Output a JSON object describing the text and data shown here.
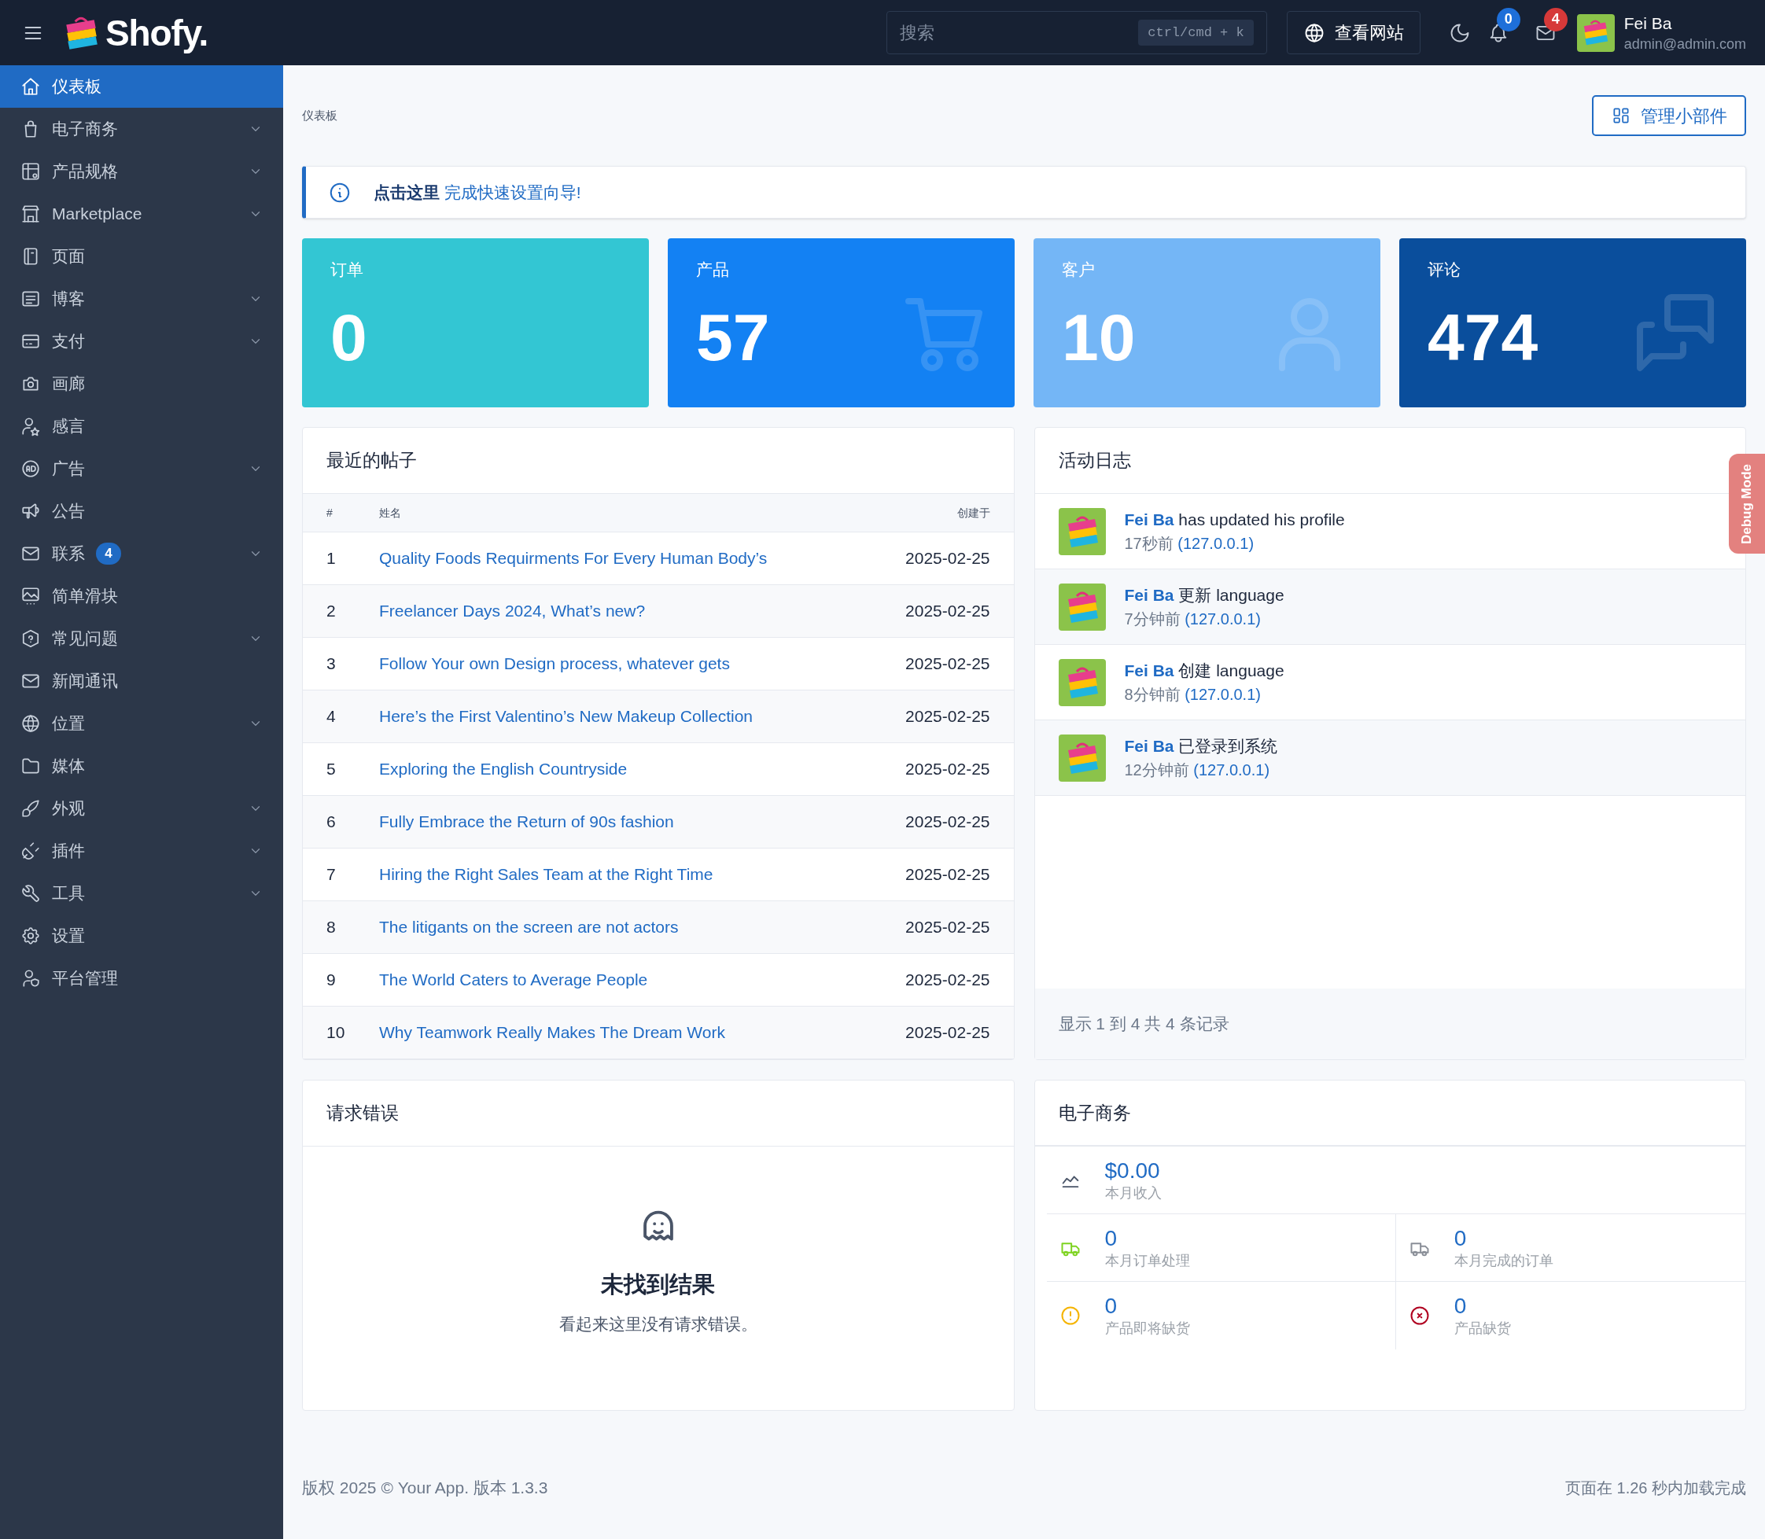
{
  "header": {
    "logo_text": "Shofy.",
    "search": {
      "placeholder": "搜索",
      "shortcut": "ctrl/cmd + k"
    },
    "view_site": "查看网站",
    "notifications_count": "0",
    "messages_count": "4",
    "user": {
      "name": "Fei Ba",
      "email": "admin@admin.com"
    }
  },
  "sidebar": {
    "items": [
      {
        "label": "仪表板",
        "selected": true,
        "expandable": false
      },
      {
        "label": "电子商务",
        "selected": false,
        "expandable": true
      },
      {
        "label": "产品规格",
        "selected": false,
        "expandable": true
      },
      {
        "label": "Marketplace",
        "selected": false,
        "expandable": true
      },
      {
        "label": "页面",
        "selected": false,
        "expandable": false
      },
      {
        "label": "博客",
        "selected": false,
        "expandable": true
      },
      {
        "label": "支付",
        "selected": false,
        "expandable": true
      },
      {
        "label": "画廊",
        "selected": false,
        "expandable": false
      },
      {
        "label": "感言",
        "selected": false,
        "expandable": false
      },
      {
        "label": "广告",
        "selected": false,
        "expandable": true
      },
      {
        "label": "公告",
        "selected": false,
        "expandable": false
      },
      {
        "label": "联系",
        "selected": false,
        "expandable": true,
        "badge": "4"
      },
      {
        "label": "简单滑块",
        "selected": false,
        "expandable": false
      },
      {
        "label": "常见问题",
        "selected": false,
        "expandable": true
      },
      {
        "label": "新闻通讯",
        "selected": false,
        "expandable": false
      },
      {
        "label": "位置",
        "selected": false,
        "expandable": true
      },
      {
        "label": "媒体",
        "selected": false,
        "expandable": false
      },
      {
        "label": "外观",
        "selected": false,
        "expandable": true
      },
      {
        "label": "插件",
        "selected": false,
        "expandable": true
      },
      {
        "label": "工具",
        "selected": false,
        "expandable": true
      },
      {
        "label": "设置",
        "selected": false,
        "expandable": false
      },
      {
        "label": "平台管理",
        "selected": false,
        "expandable": false
      }
    ]
  },
  "breadcrumb": "仪表板",
  "manage_widgets_button": "管理小部件",
  "setup_alert": {
    "link": "点击这里",
    "text": "完成快速设置向导!"
  },
  "stats": [
    {
      "label": "订单",
      "value": "0",
      "color": "#33c6d3"
    },
    {
      "label": "产品",
      "value": "57",
      "color": "#1381f3"
    },
    {
      "label": "客户",
      "value": "10",
      "color": "#74b6f6"
    },
    {
      "label": "评论",
      "value": "474",
      "color": "#0a4e9c"
    }
  ],
  "recent_posts": {
    "title": "最近的帖子",
    "columns": [
      "#",
      "姓名",
      "创建于"
    ],
    "rows": [
      {
        "number": "1",
        "title": "Quality Foods Requirments For Every Human Body’s",
        "date": "2025-02-25"
      },
      {
        "number": "2",
        "title": "Freelancer Days 2024, What’s new?",
        "date": "2025-02-25"
      },
      {
        "number": "3",
        "title": "Follow Your own Design process, whatever gets",
        "date": "2025-02-25"
      },
      {
        "number": "4",
        "title": "Here’s the First Valentino’s New Makeup Collection",
        "date": "2025-02-25"
      },
      {
        "number": "5",
        "title": "Exploring the English Countryside",
        "date": "2025-02-25"
      },
      {
        "number": "6",
        "title": "Fully Embrace the Return of 90s fashion",
        "date": "2025-02-25"
      },
      {
        "number": "7",
        "title": "Hiring the Right Sales Team at the Right Time",
        "date": "2025-02-25"
      },
      {
        "number": "8",
        "title": "The litigants on the screen are not actors",
        "date": "2025-02-25"
      },
      {
        "number": "9",
        "title": "The World Caters to Average People",
        "date": "2025-02-25"
      },
      {
        "number": "10",
        "title": "Why Teamwork Really Makes The Dream Work",
        "date": "2025-02-25"
      }
    ]
  },
  "activity_log": {
    "title": "活动日志",
    "entries": [
      {
        "user": "Fei Ba",
        "action": "has updated his profile",
        "time": "17秒前",
        "ip": "(127.0.0.1)"
      },
      {
        "user": "Fei Ba",
        "action": "更新 language",
        "time": "7分钟前",
        "ip": "(127.0.0.1)"
      },
      {
        "user": "Fei Ba",
        "action": "创建 language",
        "time": "8分钟前",
        "ip": "(127.0.0.1)"
      },
      {
        "user": "Fei Ba",
        "action": "已登录到系统",
        "time": "12分钟前",
        "ip": "(127.0.0.1)"
      }
    ],
    "summary": "显示 1 到 4 共 4 条记录"
  },
  "request_errors": {
    "title": "请求错误",
    "empty_title": "未找到结果",
    "empty_text": "看起来这里没有请求错误。"
  },
  "ecommerce": {
    "title": "电子商务",
    "revenue": {
      "value": "$0.00",
      "label": "本月收入"
    },
    "stats": [
      {
        "value": "0",
        "label": "本月订单处理",
        "color": "#7ed321"
      },
      {
        "value": "0",
        "label": "本月完成的订单",
        "color": "#8a8f98"
      },
      {
        "value": "0",
        "label": "产品即将缺货",
        "color": "#f5b400"
      },
      {
        "value": "0",
        "label": "产品缺货",
        "color": "#b00020"
      }
    ]
  },
  "footer": {
    "copyright": "版权 2025 © Your App. 版本 1.3.3",
    "load_time": "页面在 1.26 秒内加载完成"
  },
  "debug_tab": "Debug Mode"
}
